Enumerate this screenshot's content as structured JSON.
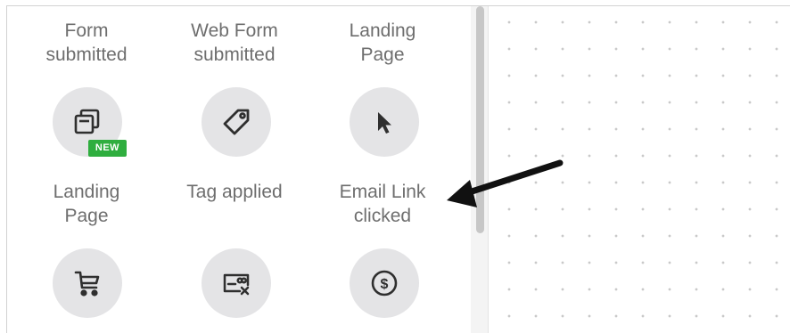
{
  "triggers": [
    {
      "label": "Form\nsubmitted",
      "icon": "forms-copy-icon",
      "badge": "NEW"
    },
    {
      "label": "Web Form\nsubmitted",
      "icon": "tag-icon"
    },
    {
      "label": "Landing\nPage",
      "icon": "cursor-pointer-icon"
    },
    {
      "label": "Landing\nPage",
      "icon": "shopping-cart-icon"
    },
    {
      "label": "Tag applied",
      "icon": "tag-removed-card-icon"
    },
    {
      "label": "Email Link\nclicked",
      "icon": "dollar-coin-icon"
    }
  ],
  "colors": {
    "tile_bg": "#e4e4e6",
    "label_text": "#6e6e6e",
    "badge_bg": "#2fae3f",
    "icon_stroke": "#2f2f2f",
    "annotation_arrow": "#111111"
  },
  "annotation": {
    "type": "arrow",
    "points_to": "Email Link clicked"
  }
}
